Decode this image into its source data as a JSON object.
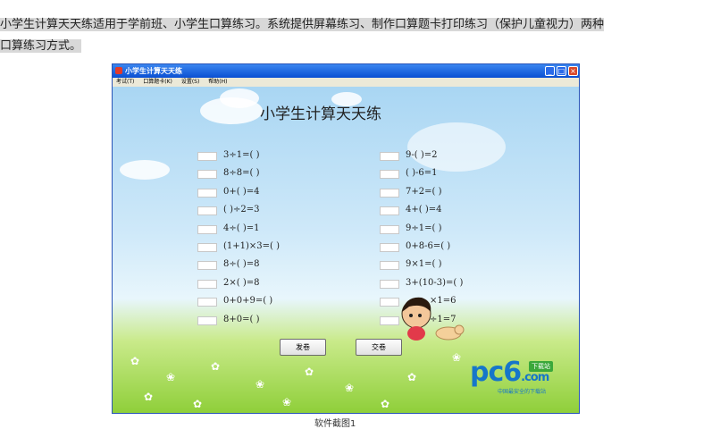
{
  "intro": {
    "line1": "小学生计算天天练适用于学前班、小学生口算练习。系统提供屏幕练习、制作口算题卡打印练习（保护儿童视力）两种",
    "line2": "口算练习方式。"
  },
  "window": {
    "title": "小学生计算天天练",
    "controls": {
      "minimize": "_",
      "maximize": "□",
      "close": "×"
    },
    "menu": [
      "考试(T)",
      "口算题卡(K)",
      "设置(S)",
      "帮助(H)"
    ]
  },
  "app": {
    "title": "小学生计算天天练",
    "left_problems": [
      "3÷1=(   )",
      "8÷8=(   )",
      "0+(   )=4",
      "(   )÷2=3",
      "4÷(   )=1",
      "(1+1)×3=(   )",
      "8÷(   )=8",
      "2×(   )=8",
      "0+0+9=(   )",
      "8+0=(   )"
    ],
    "right_problems": [
      "9-(   )=2",
      "(   )-6=1",
      "7+2=(   )",
      "4+(   )=4",
      "9÷1=(   )",
      "0+8-6=(   )",
      "9×1=(   )",
      "3+(10-3)=(   )",
      "×1=6",
      "÷1=7"
    ],
    "buttons": {
      "submit_paper": "发卷",
      "hand_in": "交卷"
    }
  },
  "logo": {
    "main": "pc6",
    "com": ".com",
    "tag": "下载站",
    "sub": "中国最安全的下载站"
  },
  "caption": "软件截图1"
}
